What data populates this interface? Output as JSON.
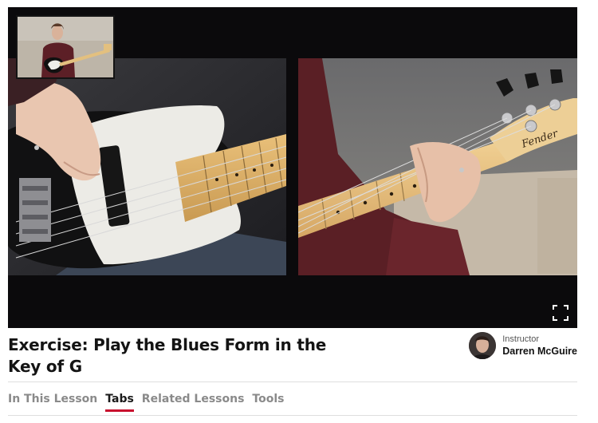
{
  "video": {
    "left_view": "bass-closeup-plucking",
    "right_view": "bass-neck-fretting",
    "pip_view": "performer-wide",
    "fullscreen_icon": "fullscreen-icon"
  },
  "lesson": {
    "title": "Exercise: Play the Blues Form in the Key of G"
  },
  "instructor": {
    "label": "Instructor",
    "name": "Darren McGuire"
  },
  "tabs": [
    {
      "label": "In This Lesson",
      "active": false
    },
    {
      "label": "Tabs",
      "active": true
    },
    {
      "label": "Related Lessons",
      "active": false
    },
    {
      "label": "Tools",
      "active": false
    }
  ],
  "colors": {
    "accent": "#c8102e",
    "player_bg": "#0b0a0c",
    "inactive_tab": "#8a8a8a"
  }
}
